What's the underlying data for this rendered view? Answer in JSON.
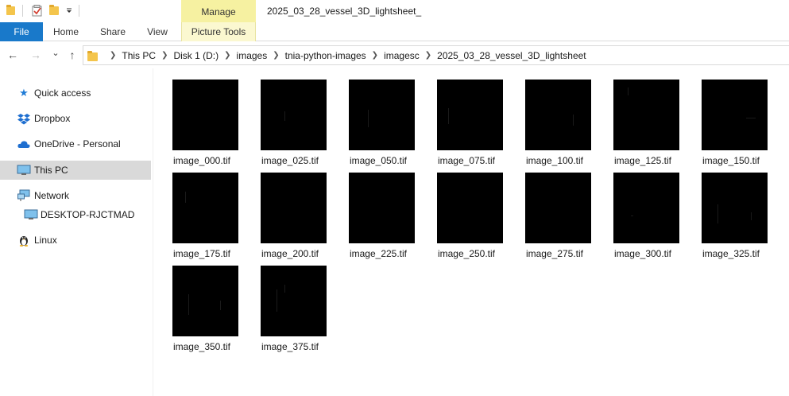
{
  "quick_access": {
    "icons": [
      "folder-icon",
      "properties-checkbox-icon",
      "new-folder-icon",
      "customize-dropdown-icon"
    ]
  },
  "title_bar": {
    "manage_label": "Manage",
    "title": "2025_03_28_vessel_3D_lightsheet_"
  },
  "ribbon": {
    "tabs": [
      {
        "label": "File"
      },
      {
        "label": "Home"
      },
      {
        "label": "Share"
      },
      {
        "label": "View"
      },
      {
        "label": "Picture Tools"
      }
    ]
  },
  "nav": {
    "back": "←",
    "forward": "→",
    "recent": "⌄",
    "up": "↑"
  },
  "breadcrumb": [
    {
      "label": "This PC"
    },
    {
      "label": "Disk 1 (D:)"
    },
    {
      "label": "images"
    },
    {
      "label": "tnia-python-images"
    },
    {
      "label": "imagesc"
    },
    {
      "label": "2025_03_28_vessel_3D_lightsheet"
    }
  ],
  "sidebar": {
    "items": [
      {
        "label": "Quick access",
        "icon": "star-icon",
        "color": "#1f7bd6"
      },
      {
        "label": "Dropbox",
        "icon": "dropbox-icon",
        "color": "#1f6fd0"
      },
      {
        "label": "OneDrive - Personal",
        "icon": "cloud-icon",
        "color": "#1f6fd0"
      },
      {
        "label": "This PC",
        "icon": "computer-icon",
        "color": "#3b88c9",
        "selected": true
      },
      {
        "label": "Network",
        "icon": "network-icon",
        "color": "#3b88c9"
      },
      {
        "label": "DESKTOP-RJCTMAD",
        "icon": "desktop-icon",
        "color": "#3b88c9"
      },
      {
        "label": "Linux",
        "icon": "linux-penguin-icon",
        "color": "#222222"
      }
    ]
  },
  "files": [
    {
      "name": "image_000.tif"
    },
    {
      "name": "image_025.tif"
    },
    {
      "name": "image_050.tif"
    },
    {
      "name": "image_075.tif"
    },
    {
      "name": "image_100.tif"
    },
    {
      "name": "image_125.tif"
    },
    {
      "name": "image_150.tif"
    },
    {
      "name": "image_175.tif"
    },
    {
      "name": "image_200.tif"
    },
    {
      "name": "image_225.tif"
    },
    {
      "name": "image_250.tif"
    },
    {
      "name": "image_275.tif"
    },
    {
      "name": "image_300.tif"
    },
    {
      "name": "image_325.tif"
    },
    {
      "name": "image_350.tif"
    },
    {
      "name": "image_375.tif"
    }
  ]
}
